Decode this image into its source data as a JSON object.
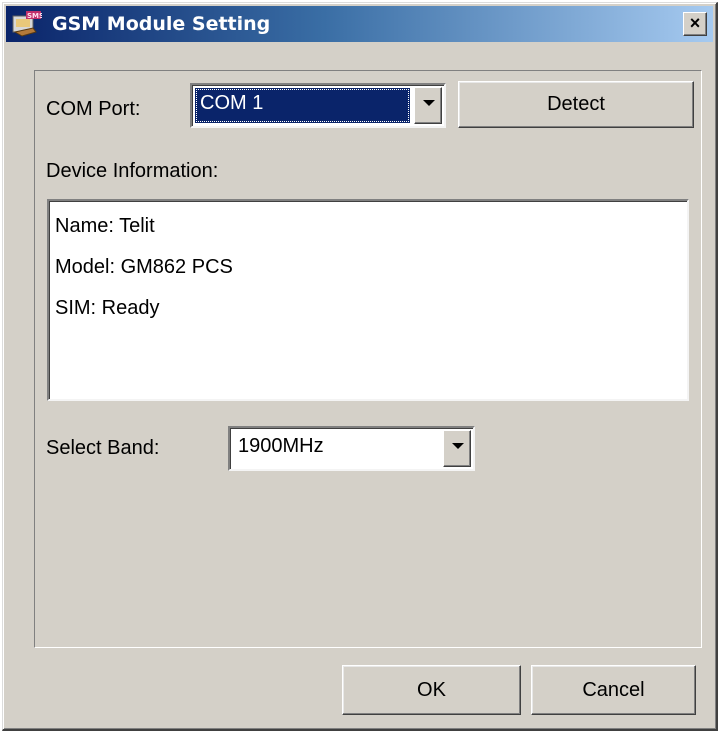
{
  "window": {
    "title": "GSM Module Setting",
    "close_symbol": "×",
    "icon": "sms-app-icon"
  },
  "com_port": {
    "label": "COM Port:",
    "selected": "COM 1"
  },
  "detect_button": {
    "label": "Detect"
  },
  "device_info": {
    "label": "Device Information:",
    "lines": [
      "Name: Telit",
      "Model: GM862 PCS",
      "SIM: Ready"
    ]
  },
  "band": {
    "label": "Select Band:",
    "selected": "1900MHz"
  },
  "footer": {
    "ok_label": "OK",
    "cancel_label": "Cancel"
  },
  "colors": {
    "face": "#d4d0c8",
    "titlebar_start": "#0a246a",
    "titlebar_end": "#a6caf0",
    "selection": "#0a246a"
  }
}
